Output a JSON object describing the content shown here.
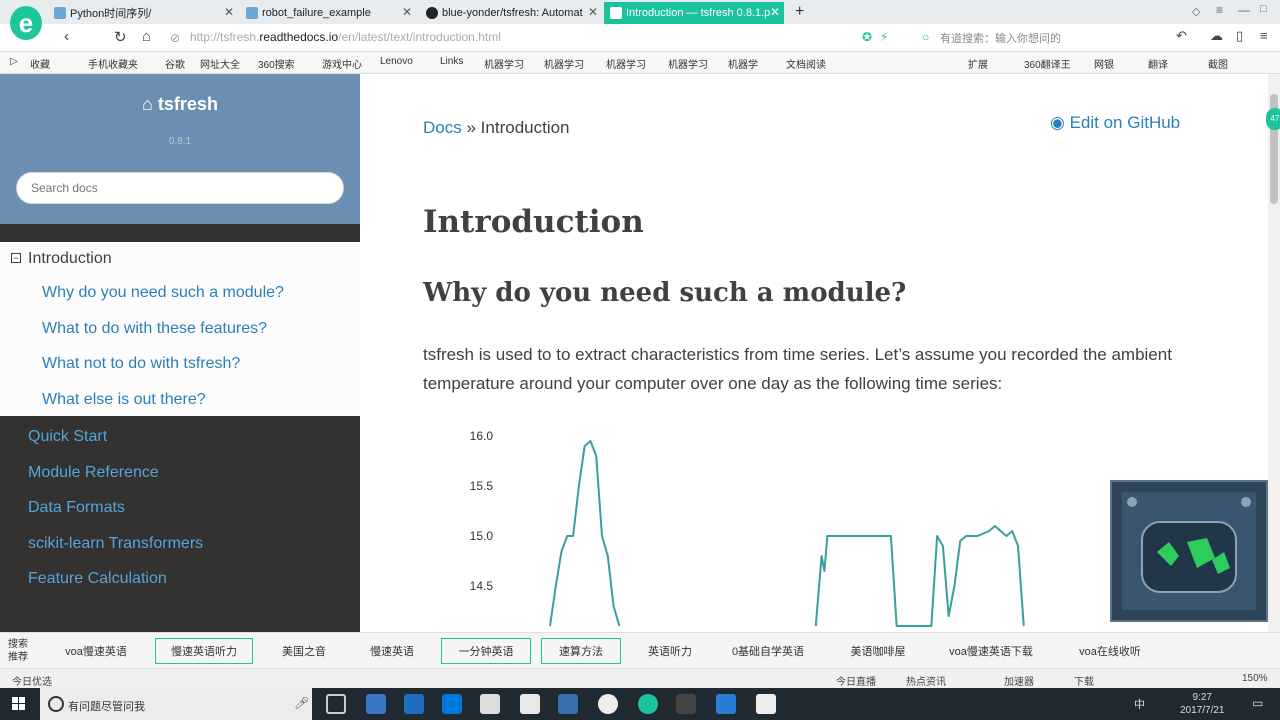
{
  "browser": {
    "tabs": [
      {
        "label": "Python时间序列/"
      },
      {
        "label": "robot_failure_example"
      },
      {
        "label": "blue-yonder/tsfresh: Automat"
      },
      {
        "label": "Introduction — tsfresh 0.8.1.p"
      }
    ],
    "new_tab": "+",
    "url_prefix": "http://tsfresh.",
    "url_domain": "readthedocs.io",
    "url_path": "/en/latest/text/introduction.html",
    "address_search_placeholder": "有道搜索：输入你想问的",
    "accent_color": "#1cc49d"
  },
  "bookmarks": [
    "收藏",
    "手机收藏夹",
    "谷歌",
    "网址大全",
    "360搜索",
    "游戏中心",
    "Lenovo",
    "Links",
    "机器学习",
    "机器学习",
    "机器学习",
    "机器学习",
    "机器学",
    "文档阅读"
  ],
  "bookmarks_right": [
    "扩展",
    "360翻译王",
    "网银",
    "翻译",
    "截图"
  ],
  "sidebar": {
    "logo": "tsfresh",
    "version": "0.8.1",
    "search_placeholder": "Search docs",
    "current": "Introduction",
    "toggle_symbol": "−",
    "sub_items": [
      "Why do you need such a module?",
      "What to do with these features?",
      "What not to do with tsfresh?",
      "What else is out there?"
    ],
    "items": [
      "Quick Start",
      "Module Reference",
      "Data Formats",
      "scikit-learn Transformers",
      "Feature Calculation"
    ]
  },
  "main": {
    "breadcrumb_docs": "Docs",
    "breadcrumb_sep": "»",
    "breadcrumb_current": "Introduction",
    "edit_link": "Edit on GitHub",
    "title": "Introduction",
    "subtitle": "Why do you need such a module?",
    "paragraph": "tsfresh is used to to extract characteristics from time series. Let’s assume you recorded the ambient temperature around your computer over one day as the following time series:"
  },
  "chart_data": {
    "type": "line",
    "title": "",
    "xlabel": "",
    "ylabel": "",
    "ylim": [
      14.2,
      16.0
    ],
    "yticks": [
      "16.0",
      "15.5",
      "15.0",
      "14.5"
    ],
    "grid": false,
    "color": "#3a9e9a",
    "series": [
      {
        "values": [
          [
            0,
            14.1
          ],
          [
            1,
            14.5
          ],
          [
            2,
            14.85
          ],
          [
            3,
            15.0
          ],
          [
            4,
            15.0
          ],
          [
            5,
            15.5
          ],
          [
            6,
            15.9
          ],
          [
            7,
            15.95
          ],
          [
            8,
            15.8
          ],
          [
            9,
            15.0
          ],
          [
            10,
            14.8
          ],
          [
            11,
            14.3
          ],
          [
            12,
            14.1
          ],
          [
            46,
            14.1
          ],
          [
            47,
            14.8
          ],
          [
            47.5,
            14.65
          ],
          [
            48,
            15.0
          ],
          [
            49,
            15.0
          ],
          [
            52,
            15.0
          ],
          [
            54,
            15.0
          ],
          [
            58,
            15.0
          ],
          [
            59,
            15.0
          ],
          [
            60,
            14.1
          ],
          [
            66,
            14.1
          ],
          [
            67,
            15.0
          ],
          [
            68,
            14.9
          ],
          [
            69,
            14.2
          ],
          [
            70,
            14.5
          ],
          [
            71,
            14.95
          ],
          [
            72,
            15.0
          ],
          [
            74,
            15.0
          ],
          [
            76,
            15.05
          ],
          [
            77,
            15.1
          ],
          [
            78,
            15.05
          ],
          [
            79,
            15.0
          ],
          [
            80,
            15.05
          ],
          [
            81,
            14.9
          ],
          [
            82,
            14.1
          ]
        ]
      }
    ]
  },
  "suggest_bar": {
    "label": "搜索推荐",
    "items": [
      "voa慢速英语",
      "慢速英语听力",
      "美国之音",
      "慢速英语",
      "一分钟英语",
      "速算方法",
      "英语听力",
      "0基础自学英语",
      "美语咖啡屋",
      "voa慢速英语下载",
      "voa在线收听"
    ]
  },
  "status_bar": {
    "left": "今日优选",
    "items": [
      "今日直播",
      "热点资讯",
      "加速器",
      "下载"
    ],
    "zoom": "150%"
  },
  "taskbar": {
    "search_placeholder": "有问题尽管问我",
    "time": "9:27",
    "date": "2017/7/21",
    "ime": "中"
  }
}
